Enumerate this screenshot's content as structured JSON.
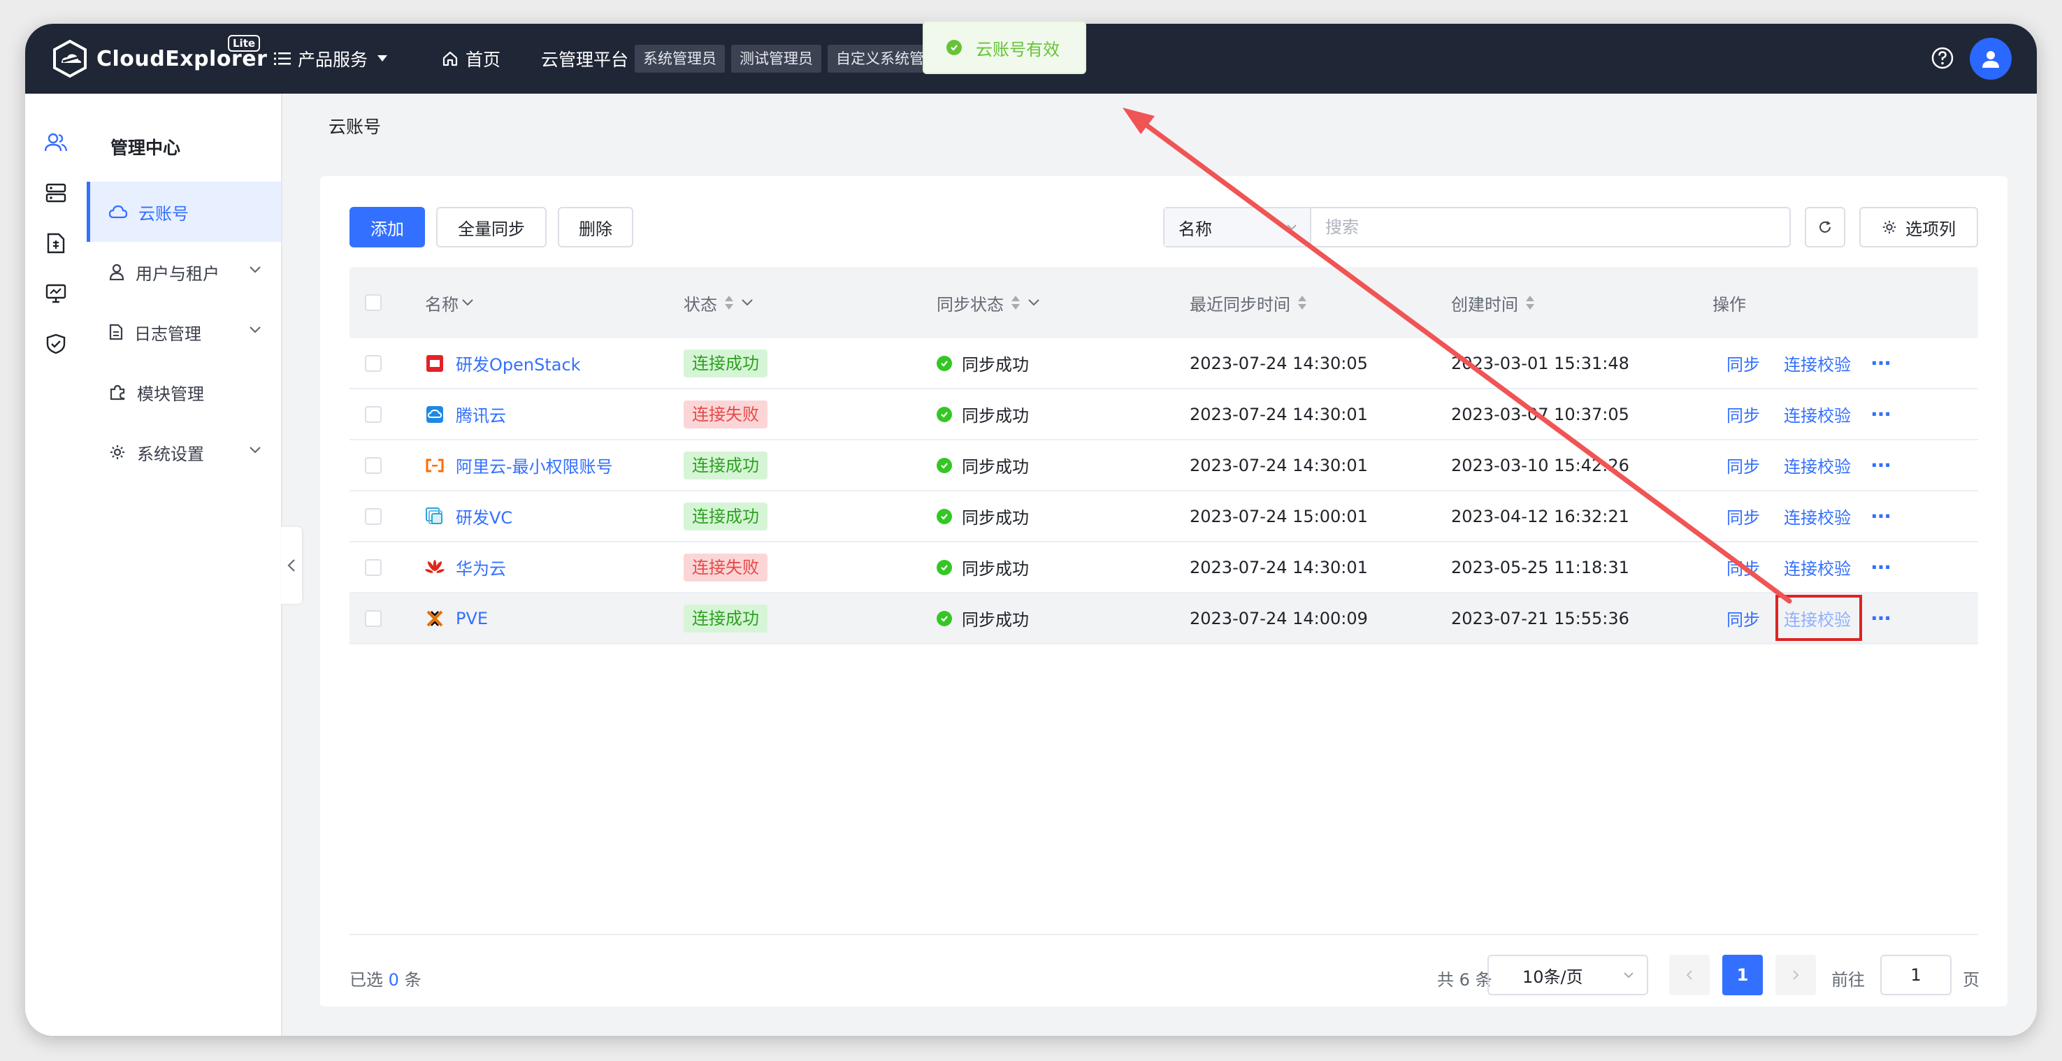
{
  "app": {
    "logo_text": "CloudExplorer",
    "logo_badge": "Lite",
    "nav": {
      "products_label": "产品服务",
      "home_label": "首页",
      "platform_label": "云管理平台",
      "roles": [
        "系统管理员",
        "测试管理员",
        "自定义系统管理员"
      ]
    },
    "icons": {
      "help": "question-circle-icon",
      "avatar": "user-icon"
    }
  },
  "toast": {
    "message": "云账号有效",
    "type": "success",
    "color": "#67c23a"
  },
  "rail": {
    "icons": [
      "users-icon",
      "server-icon",
      "document-icon",
      "monitor-icon",
      "shield-icon"
    ]
  },
  "sidebar": {
    "title": "管理中心",
    "items": [
      {
        "label": "云账号",
        "icon": "cloud-icon",
        "active": true
      },
      {
        "label": "用户与租户",
        "icon": "user-icon",
        "expandable": true
      },
      {
        "label": "日志管理",
        "icon": "log-icon",
        "expandable": true
      },
      {
        "label": "模块管理",
        "icon": "puzzle-icon"
      },
      {
        "label": "系统设置",
        "icon": "gear-icon",
        "expandable": true
      }
    ]
  },
  "breadcrumb": "云账号",
  "toolbar": {
    "add_label": "添加",
    "sync_all_label": "全量同步",
    "delete_label": "删除",
    "search_field": "名称",
    "search_placeholder": "搜索",
    "columns_label": "选项列"
  },
  "table": {
    "headers": {
      "name": "名称",
      "status": "状态",
      "sync_status": "同步状态",
      "last_sync": "最近同步时间",
      "created": "创建时间",
      "actions": "操作"
    },
    "rows": [
      {
        "name": "研发OpenStack",
        "provider": "openstack-icon",
        "status": "连接成功",
        "status_ok": true,
        "sync": "同步成功",
        "last_sync": "2023-07-24 14:30:05",
        "created": "2023-03-01 15:31:48"
      },
      {
        "name": "腾讯云",
        "provider": "tencent-cloud-icon",
        "status": "连接失败",
        "status_ok": false,
        "sync": "同步成功",
        "last_sync": "2023-07-24 14:30:01",
        "created": "2023-03-07 10:37:05"
      },
      {
        "name": "阿里云-最小权限账号",
        "provider": "aliyun-icon",
        "status": "连接成功",
        "status_ok": true,
        "sync": "同步成功",
        "last_sync": "2023-07-24 14:30:01",
        "created": "2023-03-10 15:42:26"
      },
      {
        "name": "研发VC",
        "provider": "vmware-icon",
        "status": "连接成功",
        "status_ok": true,
        "sync": "同步成功",
        "last_sync": "2023-07-24 15:00:01",
        "created": "2023-04-12 16:32:21"
      },
      {
        "name": "华为云",
        "provider": "huawei-cloud-icon",
        "status": "连接失败",
        "status_ok": false,
        "sync": "同步成功",
        "last_sync": "2023-07-24 14:30:01",
        "created": "2023-05-25 11:18:31"
      },
      {
        "name": "PVE",
        "provider": "proxmox-icon",
        "status": "连接成功",
        "status_ok": true,
        "sync": "同步成功",
        "last_sync": "2023-07-24 14:00:09",
        "created": "2023-07-21 15:55:36"
      }
    ],
    "row_actions": {
      "sync": "同步",
      "verify": "连接校验",
      "more": "···"
    }
  },
  "footer": {
    "selected_prefix": "已选",
    "selected_count": "0",
    "selected_suffix": "条",
    "total": "共 6 条",
    "page_size": "10条/页",
    "current_page": "1",
    "goto_prefix": "前往",
    "goto_value": "1",
    "goto_suffix": "页"
  },
  "colors": {
    "accent": "#3370ff",
    "topbar": "#1f2635",
    "success": "#2ea121",
    "danger": "#e64a4a",
    "annotation": "#e02222"
  }
}
